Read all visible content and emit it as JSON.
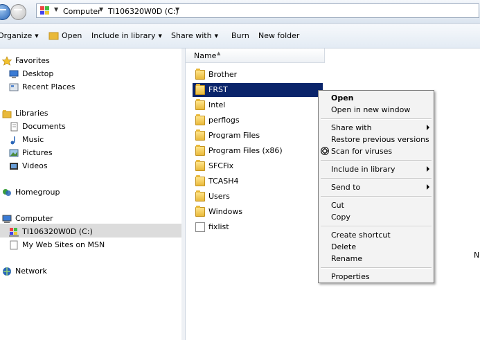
{
  "address": {
    "crumbs": [
      "Computer",
      "TI106320W0D (C:)"
    ]
  },
  "toolbar": {
    "organize": "Organize",
    "open": "Open",
    "include_in_library": "Include in library",
    "share_with": "Share with",
    "burn": "Burn",
    "new_folder": "New folder"
  },
  "nav": {
    "favorites": "Favorites",
    "desktop": "Desktop",
    "recent_places": "Recent Places",
    "libraries": "Libraries",
    "documents": "Documents",
    "music": "Music",
    "pictures": "Pictures",
    "videos": "Videos",
    "homegroup": "Homegroup",
    "computer": "Computer",
    "drive_c": "TI106320W0D (C:)",
    "my_web_sites": "My Web Sites on MSN",
    "network": "Network"
  },
  "content": {
    "column_name": "Name",
    "files": [
      {
        "name": "Brother",
        "type": "folder"
      },
      {
        "name": "FRST",
        "type": "folder"
      },
      {
        "name": "Intel",
        "type": "folder"
      },
      {
        "name": "perflogs",
        "type": "folder"
      },
      {
        "name": "Program Files",
        "type": "folder"
      },
      {
        "name": "Program Files (x86)",
        "type": "folder"
      },
      {
        "name": "SFCFix",
        "type": "folder"
      },
      {
        "name": "TCASH4",
        "type": "folder"
      },
      {
        "name": "Users",
        "type": "folder"
      },
      {
        "name": "Windows",
        "type": "folder"
      },
      {
        "name": "fixlist",
        "type": "document"
      }
    ],
    "truncated_right": "N"
  },
  "context_menu": {
    "open": "Open",
    "open_new_window": "Open in new window",
    "share_with": "Share with",
    "restore_previous": "Restore previous versions",
    "scan_for_viruses": "Scan for viruses",
    "include_in_library": "Include in library",
    "send_to": "Send to",
    "cut": "Cut",
    "copy": "Copy",
    "create_shortcut": "Create shortcut",
    "delete": "Delete",
    "rename": "Rename",
    "properties": "Properties"
  }
}
